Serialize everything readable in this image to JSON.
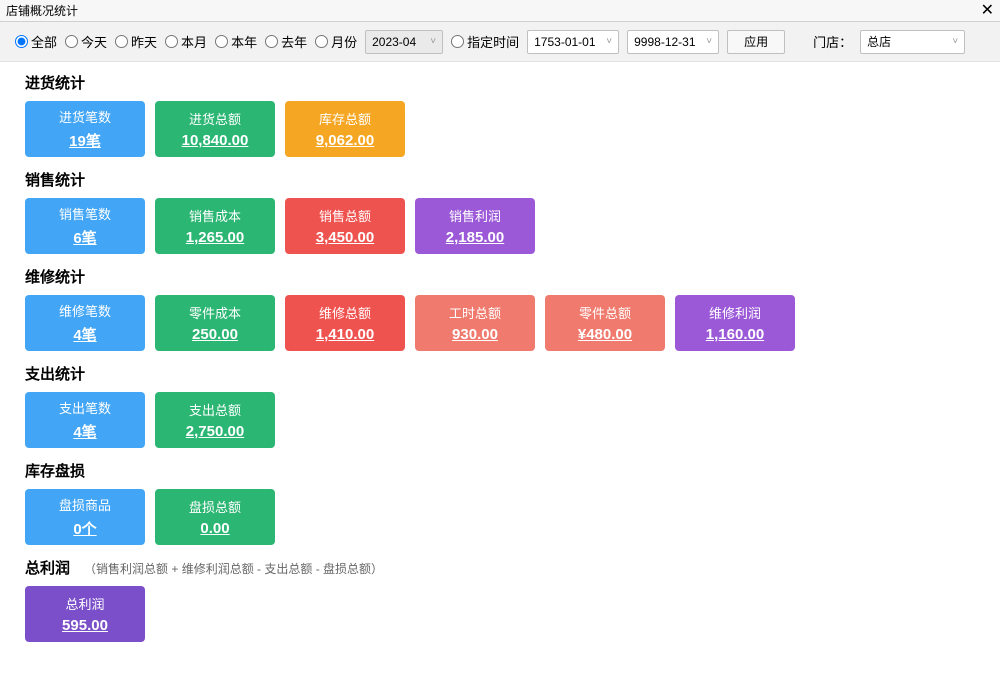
{
  "window": {
    "title": "店铺概况统计",
    "close": "✕"
  },
  "filters": {
    "radios": {
      "all": "全部",
      "today": "今天",
      "yesterday": "昨天",
      "this_month": "本月",
      "this_year": "本年",
      "last_year": "去年",
      "by_month": "月份",
      "custom": "指定时间"
    },
    "month_value": "2023-04",
    "date_from": "1753-01-01",
    "date_to": "9998-12-31",
    "apply": "应用",
    "store_label": "门店：",
    "store_value": "总店"
  },
  "sections": {
    "purchase": {
      "title": "进货统计",
      "cards": [
        {
          "label": "进货笔数",
          "value": "19笔"
        },
        {
          "label": "进货总额",
          "value": "10,840.00"
        },
        {
          "label": "库存总额",
          "value": "9,062.00"
        }
      ]
    },
    "sales": {
      "title": "销售统计",
      "cards": [
        {
          "label": "销售笔数",
          "value": "6笔"
        },
        {
          "label": "销售成本",
          "value": "1,265.00"
        },
        {
          "label": "销售总额",
          "value": "3,450.00"
        },
        {
          "label": "销售利润",
          "value": "2,185.00"
        }
      ]
    },
    "repair": {
      "title": "维修统计",
      "cards": [
        {
          "label": "维修笔数",
          "value": "4笔"
        },
        {
          "label": "零件成本",
          "value": "250.00"
        },
        {
          "label": "维修总额",
          "value": "1,410.00"
        },
        {
          "label": "工时总额",
          "value": "930.00"
        },
        {
          "label": "零件总额",
          "value": "¥480.00"
        },
        {
          "label": "维修利润",
          "value": "1,160.00"
        }
      ]
    },
    "expense": {
      "title": "支出统计",
      "cards": [
        {
          "label": "支出笔数",
          "value": "4笔"
        },
        {
          "label": "支出总额",
          "value": "2,750.00"
        }
      ]
    },
    "loss": {
      "title": "库存盘损",
      "cards": [
        {
          "label": "盘损商品",
          "value": "0个"
        },
        {
          "label": "盘损总额",
          "value": "0.00"
        }
      ]
    },
    "profit": {
      "title": "总利润",
      "note": "（销售利润总额 + 维修利润总额 - 支出总额 - 盘损总额）",
      "cards": [
        {
          "label": "总利润",
          "value": "595.00"
        }
      ]
    }
  }
}
